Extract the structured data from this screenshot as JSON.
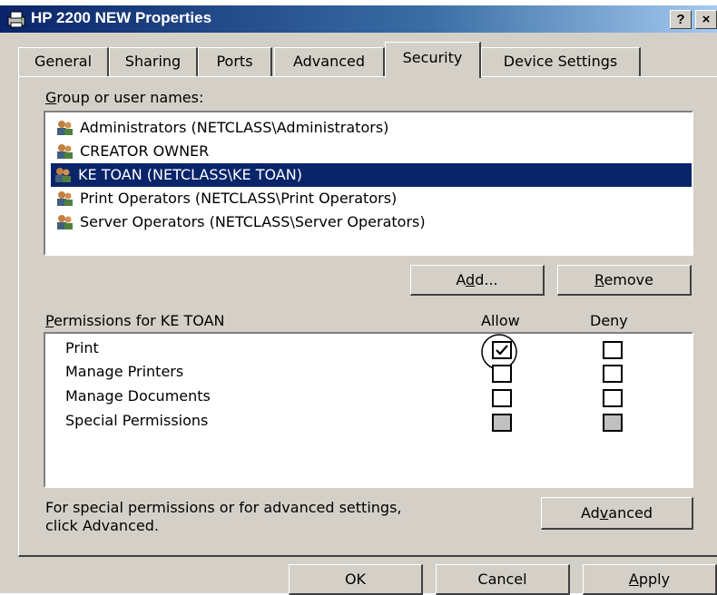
{
  "window": {
    "title": "HP 2200 NEW Properties",
    "help_button": "?",
    "close_button": "×"
  },
  "tabs": [
    {
      "label": "General"
    },
    {
      "label": "Sharing"
    },
    {
      "label": "Ports"
    },
    {
      "label": "Advanced"
    },
    {
      "label": "Security",
      "active": true
    },
    {
      "label": "Device Settings"
    }
  ],
  "groups": {
    "label_first": "G",
    "label_rest": "roup or user names:",
    "users": [
      {
        "name": "Administrators (NETCLASS\\Administrators)"
      },
      {
        "name": "CREATOR OWNER"
      },
      {
        "name": "KE TOAN (NETCLASS\\KE TOAN)",
        "selected": true
      },
      {
        "name": "Print Operators (NETCLASS\\Print Operators)"
      },
      {
        "name": "Server Operators (NETCLASS\\Server Operators)"
      }
    ]
  },
  "buttons": {
    "add_pre": "A",
    "add_u": "d",
    "add_post": "d...",
    "remove_u": "R",
    "remove_post": "emove",
    "advanced_pre": "Ad",
    "advanced_u": "v",
    "advanced_post": "anced",
    "ok": "OK",
    "cancel": "Cancel",
    "apply_u": "A",
    "apply_post": "pply"
  },
  "permissions": {
    "label_u": "P",
    "label_rest": "ermissions for KE TOAN",
    "allow_header": "Allow",
    "deny_header": "Deny",
    "items": [
      {
        "name": "Print",
        "allow": true,
        "deny": false
      },
      {
        "name": "Manage Printers",
        "allow": false,
        "deny": false
      },
      {
        "name": "Manage Documents",
        "allow": false,
        "deny": false
      },
      {
        "name": "Special Permissions",
        "allow": false,
        "deny": false,
        "disabled": true
      }
    ]
  },
  "special_note": {
    "line1": "For special permissions or for advanced settings,",
    "line2": "click Advanced."
  },
  "colors": {
    "face": "#d4d0c8",
    "title_blue": "#0a246a",
    "selection": "#0a246a"
  }
}
